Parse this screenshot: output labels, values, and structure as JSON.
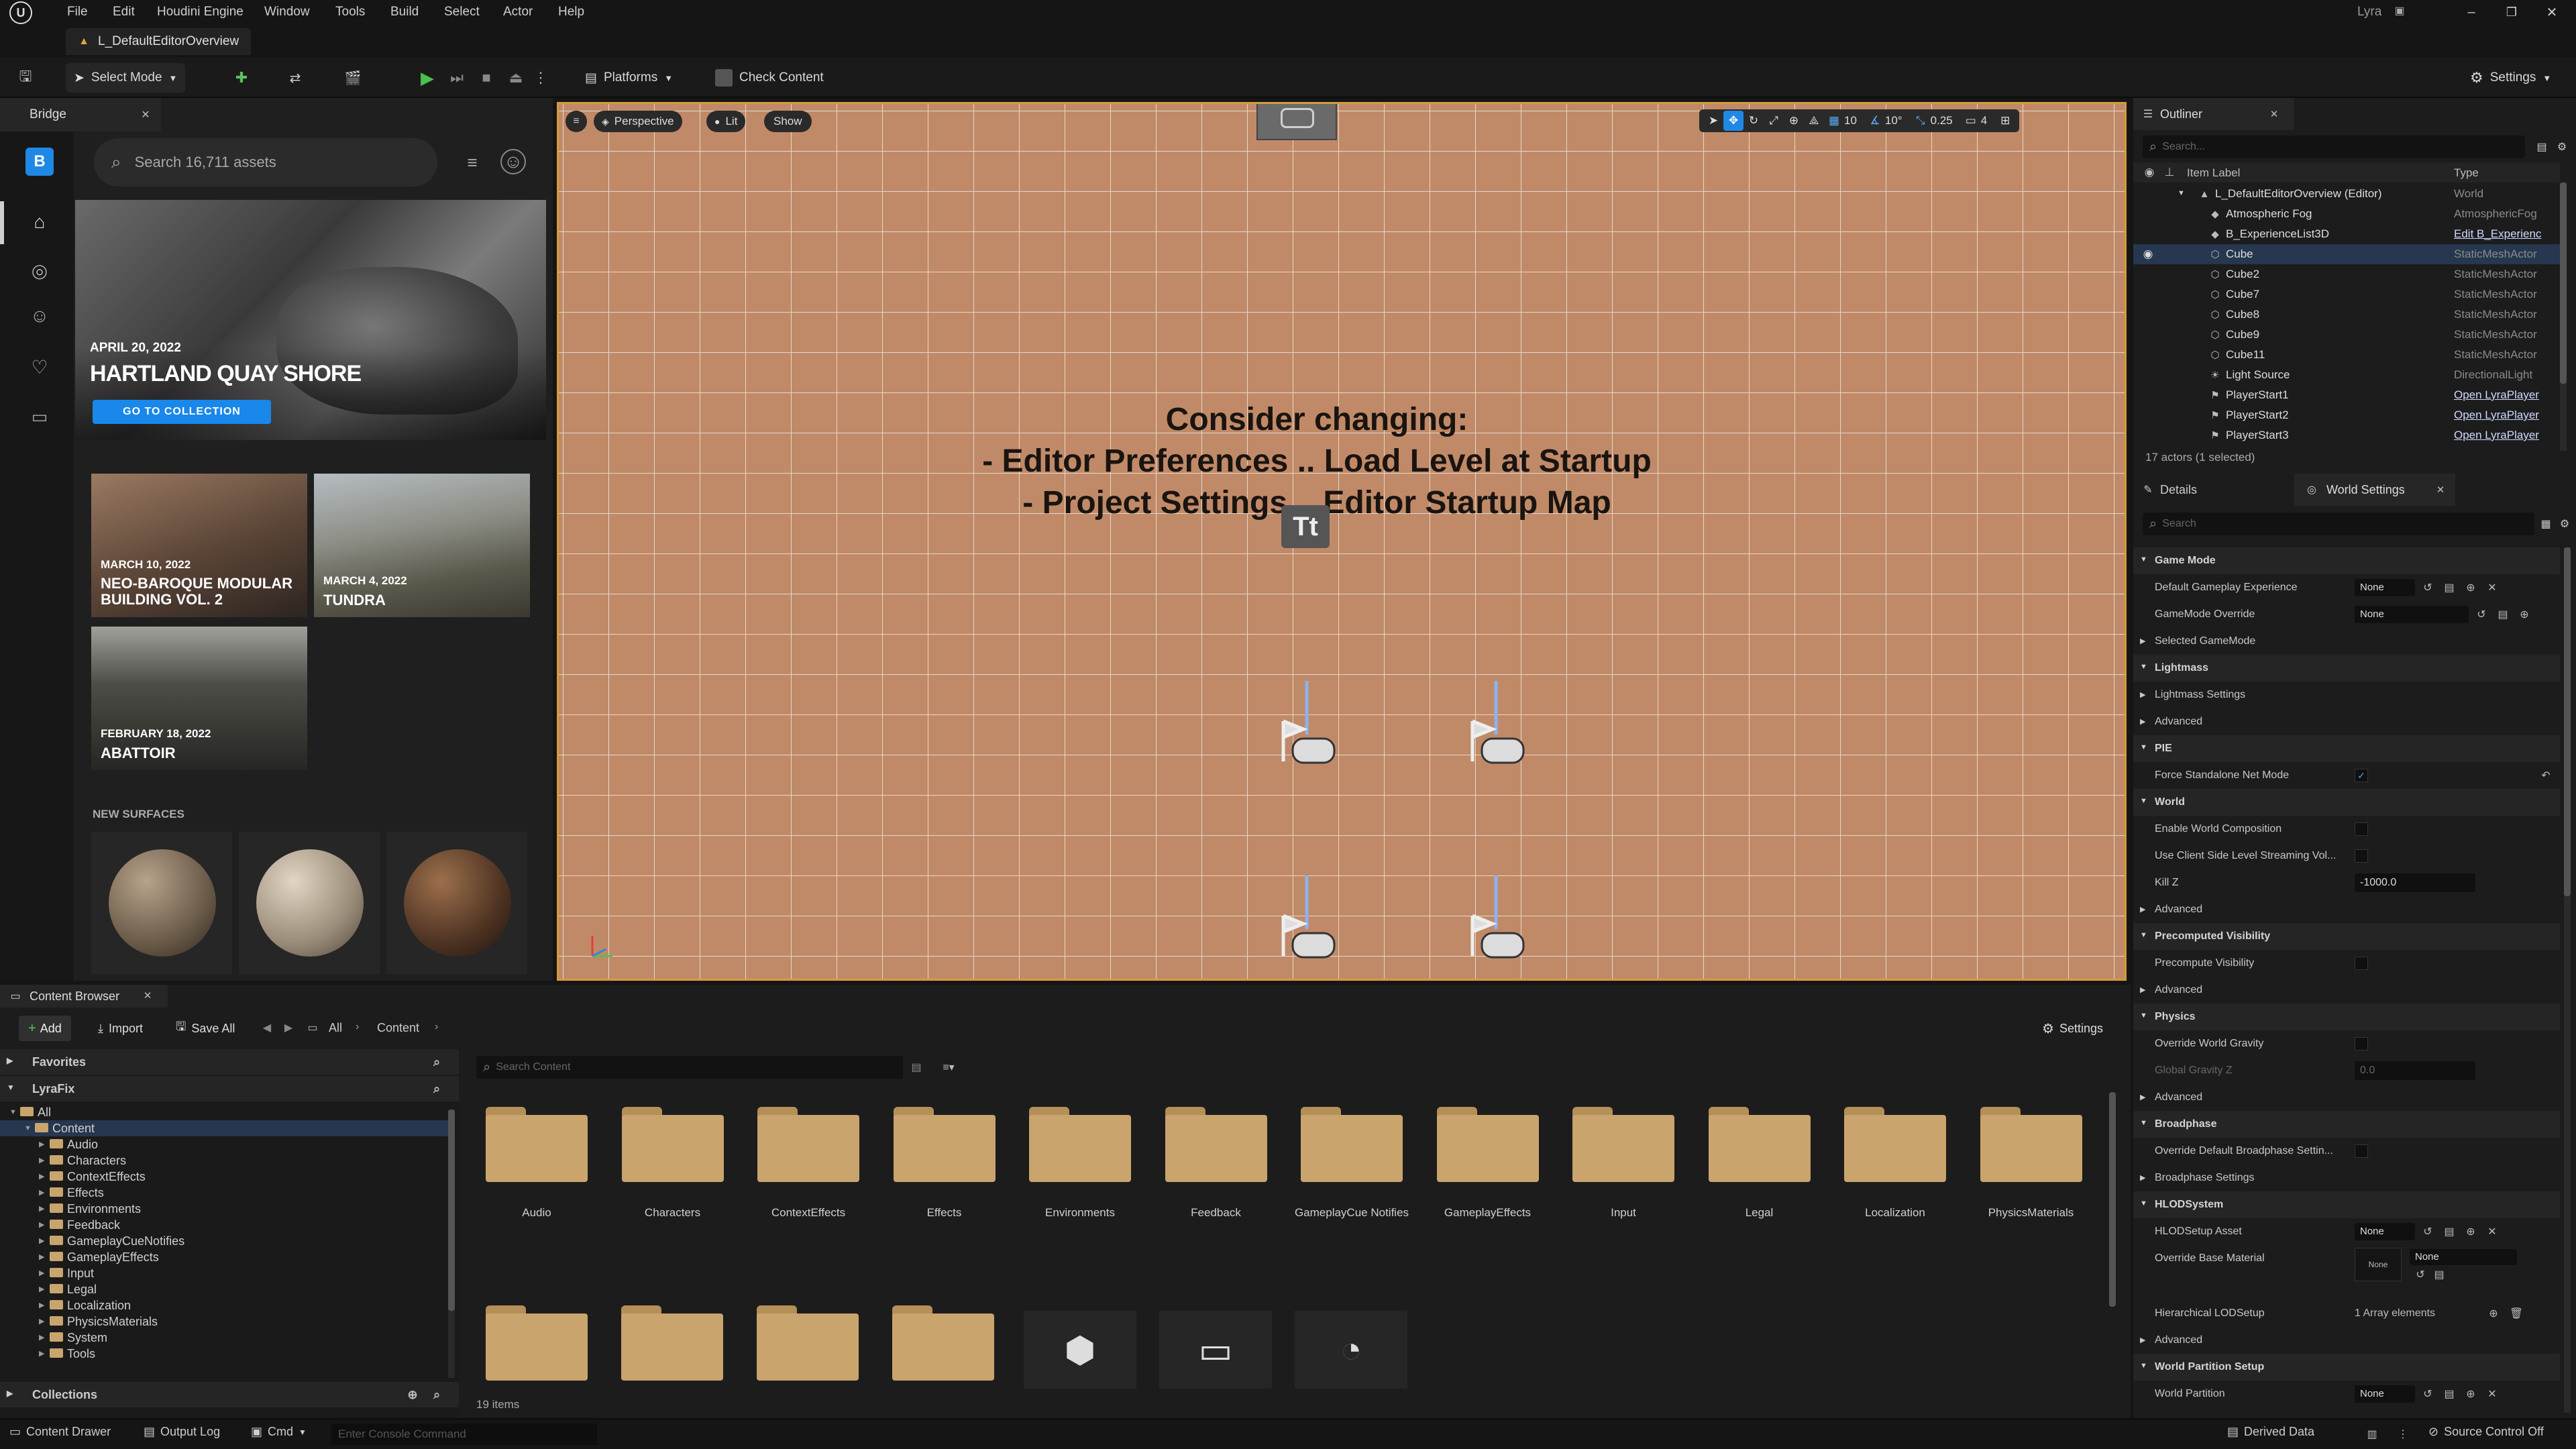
{
  "menubar": {
    "items": [
      "File",
      "Edit",
      "Houdini Engine",
      "Window",
      "Tools",
      "Build",
      "Select",
      "Actor",
      "Help"
    ],
    "project": "Lyra"
  },
  "level_tab": {
    "label": "L_DefaultEditorOverview"
  },
  "toolbar": {
    "select_mode": "Select Mode",
    "platforms": "Platforms",
    "check_content": "Check Content",
    "settings": "Settings"
  },
  "bridge": {
    "tab_label": "Bridge",
    "search_placeholder": "Search 16,711 assets",
    "hero": {
      "date": "APRIL 20, 2022",
      "title": "HARTLAND QUAY SHORE",
      "cta": "GO TO COLLECTION"
    },
    "cards": [
      {
        "date": "MARCH 10, 2022",
        "title": "NEO-BAROQUE MODULAR BUILDING VOL. 2"
      },
      {
        "date": "MARCH 4, 2022",
        "title": "TUNDRA"
      },
      {
        "date": "FEBRUARY 18, 2022",
        "title": "ABATTOIR"
      }
    ],
    "new_surfaces": "NEW SURFACES"
  },
  "viewport": {
    "perspective": "Perspective",
    "lit": "Lit",
    "show": "Show",
    "message": {
      "line1": "Consider changing:",
      "line2": "- Editor Preferences .. Load Level at Startup",
      "line3": "- Project Settings .. Editor Startup Map"
    },
    "grid_snap": "10",
    "rot_snap": "10°",
    "scale_snap": "0.25",
    "cam_speed": "4"
  },
  "outliner": {
    "tab_label": "Outliner",
    "search_placeholder": "Search...",
    "col_label": "Item Label",
    "col_type": "Type",
    "rows": [
      {
        "label": "L_DefaultEditorOverview (Editor)",
        "type": "World"
      },
      {
        "label": "Atmospheric Fog",
        "type": "AtmosphericFog"
      },
      {
        "label": "B_ExperienceList3D",
        "type": "Edit B_Experienc"
      },
      {
        "label": "Cube",
        "type": "StaticMeshActor"
      },
      {
        "label": "Cube2",
        "type": "StaticMeshActor"
      },
      {
        "label": "Cube7",
        "type": "StaticMeshActor"
      },
      {
        "label": "Cube8",
        "type": "StaticMeshActor"
      },
      {
        "label": "Cube9",
        "type": "StaticMeshActor"
      },
      {
        "label": "Cube11",
        "type": "StaticMeshActor"
      },
      {
        "label": "Light Source",
        "type": "DirectionalLight"
      },
      {
        "label": "PlayerStart1",
        "type": "Open LyraPlayer"
      },
      {
        "label": "PlayerStart2",
        "type": "Open LyraPlayer"
      },
      {
        "label": "PlayerStart3",
        "type": "Open LyraPlayer"
      }
    ],
    "footer": "17 actors (1 selected)"
  },
  "details": {
    "tab_details": "Details",
    "tab_world": "World Settings",
    "search_placeholder": "Search",
    "rows": [
      {
        "kind": "section",
        "label": "Game Mode"
      },
      {
        "kind": "prop",
        "label": "Default Gameplay Experience",
        "value": "None"
      },
      {
        "kind": "prop",
        "label": "GameMode Override",
        "value": "None"
      },
      {
        "kind": "sub",
        "label": "Selected GameMode"
      },
      {
        "kind": "section",
        "label": "Lightmass"
      },
      {
        "kind": "sub",
        "label": "Lightmass Settings"
      },
      {
        "kind": "sub",
        "label": "Advanced"
      },
      {
        "kind": "section",
        "label": "PIE"
      },
      {
        "kind": "check",
        "label": "Force Standalone Net Mode",
        "checked": true
      },
      {
        "kind": "section",
        "label": "World"
      },
      {
        "kind": "check",
        "label": "Enable World Composition",
        "checked": false
      },
      {
        "kind": "check",
        "label": "Use Client Side Level Streaming Vol...",
        "checked": false
      },
      {
        "kind": "prop",
        "label": "Kill Z",
        "value": "-1000.0"
      },
      {
        "kind": "sub",
        "label": "Advanced"
      },
      {
        "kind": "section",
        "label": "Precomputed Visibility"
      },
      {
        "kind": "check",
        "label": "Precompute Visibility",
        "checked": false
      },
      {
        "kind": "sub",
        "label": "Advanced"
      },
      {
        "kind": "section",
        "label": "Physics"
      },
      {
        "kind": "check",
        "label": "Override World Gravity",
        "checked": false
      },
      {
        "kind": "prop",
        "label": "Global Gravity Z",
        "value": "0.0"
      },
      {
        "kind": "sub",
        "label": "Advanced"
      },
      {
        "kind": "section",
        "label": "Broadphase"
      },
      {
        "kind": "check",
        "label": "Override Default Broadphase Settin...",
        "checked": false
      },
      {
        "kind": "sub",
        "label": "Broadphase Settings"
      },
      {
        "kind": "section",
        "label": "HLODSystem"
      },
      {
        "kind": "prop",
        "label": "HLODSetup Asset",
        "value": "None"
      },
      {
        "kind": "prop",
        "label": "Override Base Material",
        "value": "None"
      },
      {
        "kind": "blank",
        "label": ""
      },
      {
        "kind": "prop",
        "label": "Hierarchical LODSetup",
        "value": "1 Array elements"
      },
      {
        "kind": "sub",
        "label": "Advanced"
      },
      {
        "kind": "section",
        "label": "World Partition Setup"
      },
      {
        "kind": "prop",
        "label": "World Partition",
        "value": "None"
      }
    ]
  },
  "content_browser": {
    "tab_label": "Content Browser",
    "add": "Add",
    "import": "Import",
    "save_all": "Save All",
    "crumb_all": "All",
    "crumb_content": "Content",
    "settings": "Settings",
    "favorites": "Favorites",
    "lyrafix": "LyraFix",
    "collections": "Collections",
    "search_placeholder": "Search Content",
    "tree": [
      "All",
      "Content",
      "Audio",
      "Characters",
      "ContextEffects",
      "Effects",
      "Environments",
      "Feedback",
      "GameplayCueNotifies",
      "GameplayEffects",
      "Input",
      "Legal",
      "Localization",
      "PhysicsMaterials",
      "System",
      "Tools"
    ],
    "folders": [
      "Audio",
      "Characters",
      "ContextEffects",
      "Effects",
      "Environments",
      "Feedback",
      "GameplayCue Notifies",
      "GameplayEffects",
      "Input",
      "Legal",
      "Localization",
      "PhysicsMaterials"
    ],
    "count": "19 items"
  },
  "statusbar": {
    "content_drawer": "Content Drawer",
    "output_log": "Output Log",
    "cmd": "Cmd",
    "console_placeholder": "Enter Console Command",
    "derived_data": "Derived Data",
    "source_control": "Source Control Off"
  },
  "colors": {
    "accent": "#1f88e5",
    "viewport_floor": "#c08a68",
    "selection": "#26374f",
    "folder": "#c9a46d"
  }
}
